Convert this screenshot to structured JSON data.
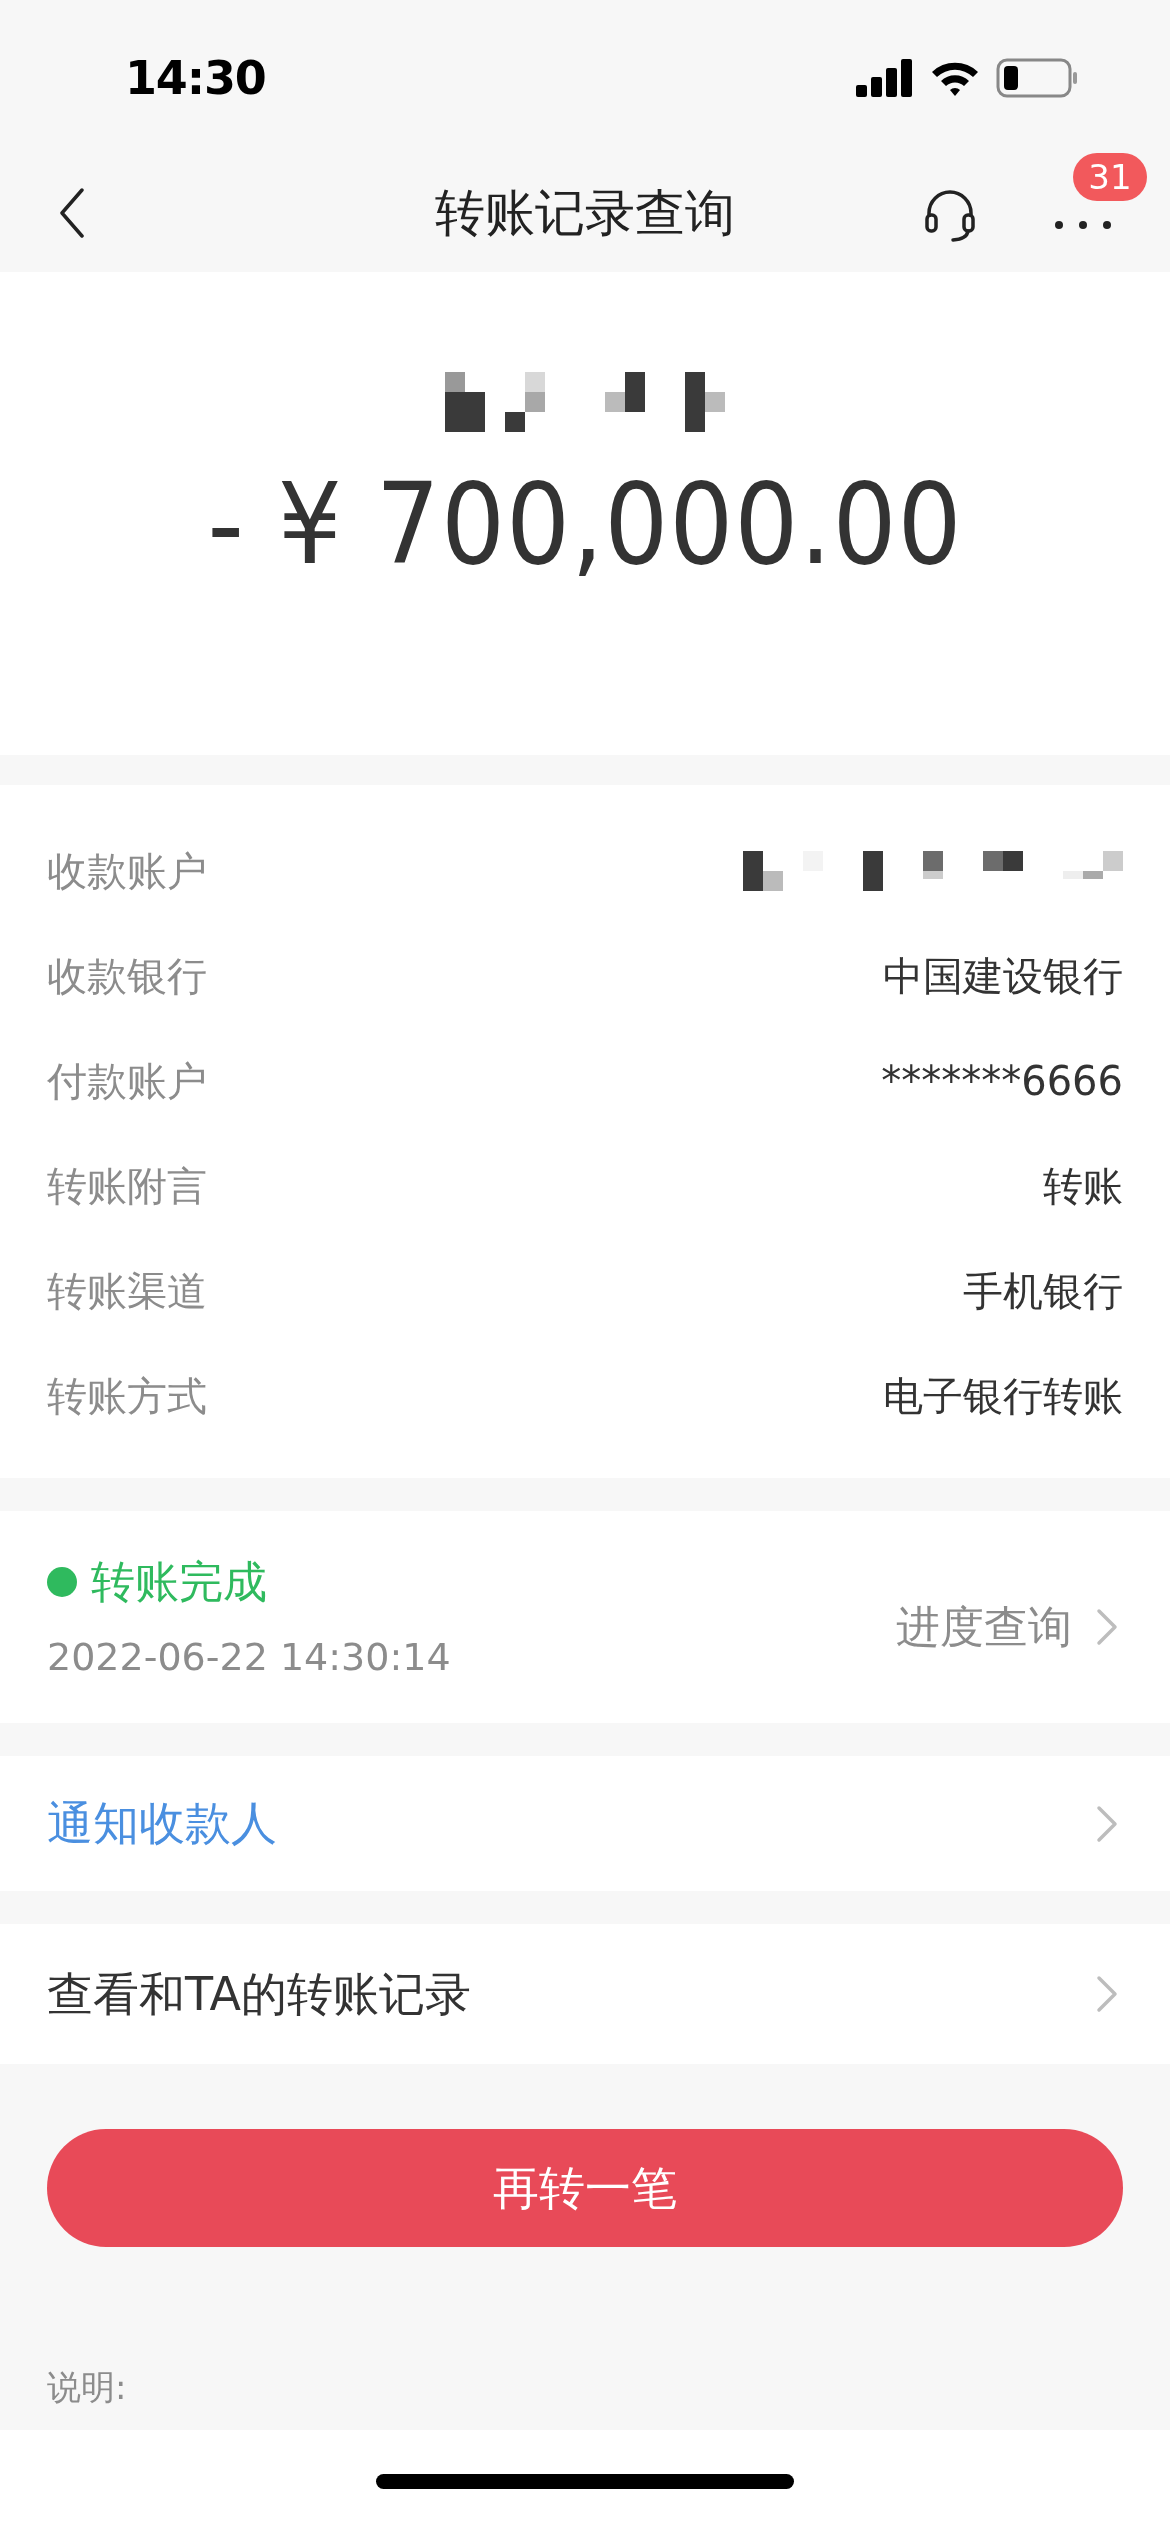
{
  "status_bar": {
    "time": "14:30"
  },
  "nav": {
    "title": "转账记录查询",
    "badge": "31"
  },
  "amount": "- ¥ 700,000.00",
  "details": [
    {
      "label": "收款账户",
      "kind": "mosaic"
    },
    {
      "label": "收款银行",
      "value": "中国建设银行"
    },
    {
      "label": "付款账户",
      "value": "*******6666"
    },
    {
      "label": "转账附言",
      "value": "转账"
    },
    {
      "label": "转账渠道",
      "value": "手机银行"
    },
    {
      "label": "转账方式",
      "value": "电子银行转账"
    }
  ],
  "status": {
    "text": "转账完成",
    "time": "2022-06-22 14:30:14",
    "link": "进度查询"
  },
  "actions": [
    {
      "label": "通知收款人",
      "kind": "link"
    },
    {
      "label": "查看和TA的转账记录",
      "kind": "plain"
    }
  ],
  "button": "再转一笔",
  "note": "说明:"
}
